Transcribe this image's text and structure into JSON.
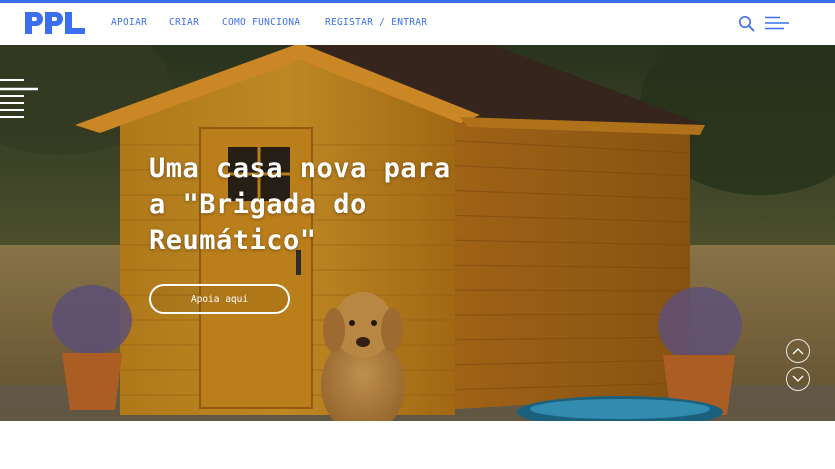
{
  "brand": {
    "logo_text": "PPL",
    "accent": "#3b6ff0"
  },
  "nav": {
    "apoiar": "APOIAR",
    "criar": "CRIAR",
    "como_funciona": "COMO FUNCIONA",
    "registar_entrar": "REGISTAR / ENTRAR"
  },
  "header_icons": [
    "search-icon",
    "menu-icon"
  ],
  "hero": {
    "title": "Uma casa nova para a \"Brigada do Reumático\"",
    "cta": "Apoia aqui",
    "icons": [
      "side-menu-icon",
      "chevron-up-icon",
      "chevron-down-icon"
    ]
  }
}
